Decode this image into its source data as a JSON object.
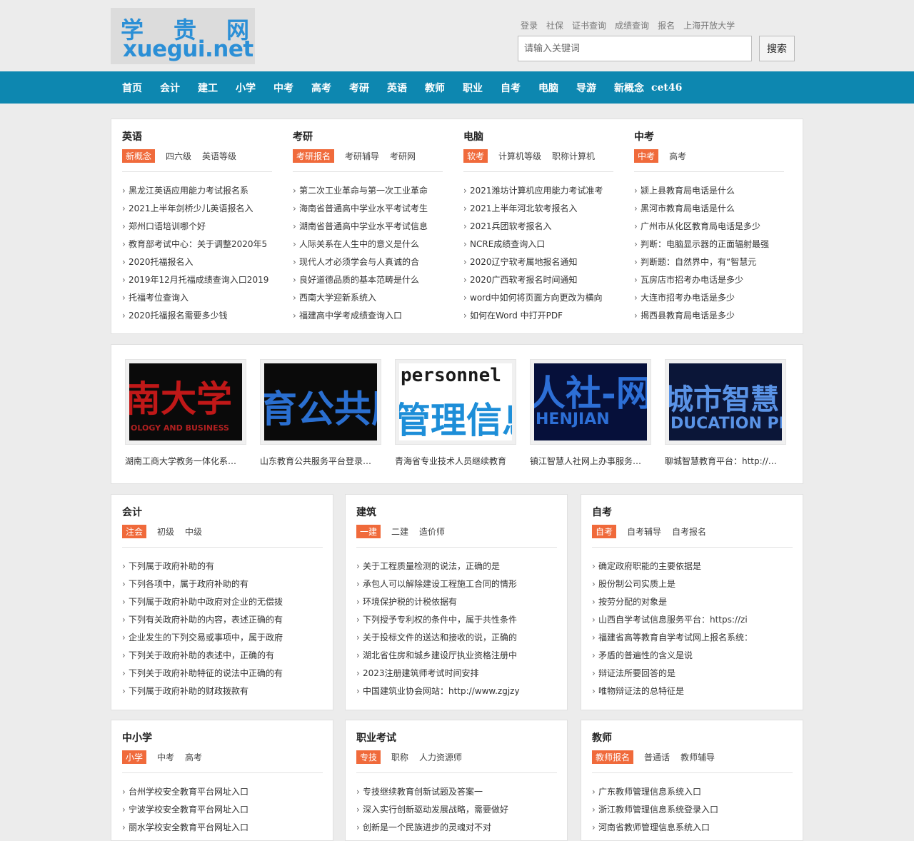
{
  "logo": {
    "zh": [
      "学",
      "贵",
      "网"
    ],
    "en": "xuegui.net"
  },
  "top_links": [
    "登录",
    "社保",
    "证书查询",
    "成绩查询",
    "报名",
    "上海开放大学"
  ],
  "search": {
    "placeholder": "请输入关键词",
    "button": "搜索"
  },
  "nav": [
    "首页",
    "会计",
    "建工",
    "小学",
    "中考",
    "高考",
    "考研",
    "英语",
    "教师",
    "职业",
    "自考",
    "电脑",
    "导游",
    "新概念",
    "cet46"
  ],
  "top_section": [
    {
      "title": "英语",
      "tabs": [
        "新概念",
        "四六级",
        "英语等级"
      ],
      "items": [
        "黑龙江英语应用能力考试报名系",
        "2021上半年剑桥少儿英语报名入",
        "郑州口语培训哪个好",
        "教育部考试中心：关于调整2020年5",
        "2020托福报名入",
        "2019年12月托福成绩查询入口2019",
        "托福考位查询入",
        "2020托福报名需要多少钱"
      ]
    },
    {
      "title": "考研",
      "tabs": [
        "考研报名",
        "考研辅导",
        "考研网"
      ],
      "items": [
        "第二次工业革命与第一次工业革命",
        "海南省普通高中学业水平考试考生",
        "湖南省普通高中学业水平考试信息",
        "人际关系在人生中的意义是什么",
        "现代人才必须学会与人真诚的合",
        "良好道德品质的基本范畴是什么",
        "西南大学迎新系统入",
        "福建高中学考成绩查询入口"
      ]
    },
    {
      "title": "电脑",
      "tabs": [
        "软考",
        "计算机等级",
        "职称计算机"
      ],
      "items": [
        "2021潍坊计算机应用能力考试准考",
        "2021上半年河北软考报名入",
        "2021兵团软考报名入",
        "NCRE成绩查询入口",
        "2020辽宁软考属地报名通知",
        "2020广西软考报名时间通知",
        "word中如何将页面方向更改为横向",
        "如何在Word 中打开PDF"
      ]
    },
    {
      "title": "中考",
      "tabs": [
        "中考",
        "高考"
      ],
      "items": [
        "颍上县教育局电话是什么",
        "黑河市教育局电话是什么",
        "广州市从化区教育局电话是多少",
        "判断：电脑显示器的正面辐射最强",
        "判断题：自然界中，有“智慧元",
        "瓦房店市招考办电话是多少",
        "大连市招考办电话是多少",
        "揭西县教育局电话是多少"
      ]
    }
  ],
  "images": [
    {
      "big": "南大学",
      "sub": "OLOGY AND BUSINESS",
      "caption": "湖南工商大学教务一体化系统入口"
    },
    {
      "big": "育公共服",
      "sub": "",
      "caption": "山东教育公共服务平台登录入口"
    },
    {
      "big": "管理信息系",
      "sub": "personnel",
      "caption": "青海省专业技术人员继续教育"
    },
    {
      "big": "人社-网上",
      "sub": "HENJIAN",
      "caption": "镇江智慧人社网上办事服务大厅"
    },
    {
      "big": "城市智慧",
      "sub": "DUCATION PLATF",
      "caption": "聊城智慧教育平台：http://www"
    }
  ],
  "middle_section": [
    {
      "title": "会计",
      "tabs": [
        "注会",
        "初级",
        "中级"
      ],
      "items": [
        "下列属于政府补助的有",
        "下列各项中，属于政府补助的有",
        "下列属于政府补助中政府对企业的无偿拨",
        "下列有关政府补助的内容，表述正确的有",
        "企业发生的下列交易或事项中，属于政府",
        "下列关于政府补助的表述中，正确的有",
        "下列关于政府补助特征的说法中正确的有",
        "下列属于政府补助的财政拨款有"
      ]
    },
    {
      "title": "建筑",
      "tabs": [
        "一建",
        "二建",
        "造价师"
      ],
      "items": [
        "关于工程质量检测的说法，正确的是",
        "承包人可以解除建设工程施工合同的情形",
        "环境保护税的计税依据有",
        "下列授予专利权的条件中，属于共性条件",
        "关于投标文件的送达和接收的说，正确的",
        "湖北省住房和城乡建设厅执业资格注册中",
        "2023注册建筑师考试时间安排",
        "中国建筑业协会网站：http://www.zgjzy"
      ]
    },
    {
      "title": "自考",
      "tabs": [
        "自考",
        "自考辅导",
        "自考报名"
      ],
      "items": [
        "确定政府职能的主要依据是",
        "股份制公司实质上是",
        "按劳分配的对象是",
        "山西自学考试信息服务平台：https://zi",
        "福建省高等教育自学考试网上报名系统：",
        "矛盾的普遍性的含义是说",
        "辩证法所要回答的是",
        "唯物辩证法的总特征是"
      ]
    }
  ],
  "bottom_section": [
    {
      "title": "中小学",
      "tabs": [
        "小学",
        "中考",
        "高考"
      ],
      "items": [
        "台州学校安全教育平台网址入口",
        "宁波学校安全教育平台网址入口",
        "丽水学校安全教育平台网址入口"
      ]
    },
    {
      "title": "职业考试",
      "tabs": [
        "专技",
        "职称",
        "人力资源师"
      ],
      "items": [
        "专技继续教育创新试题及答案一",
        "深入实行创新驱动发展战略，需要做好",
        "创新是一个民族进步的灵魂对不对"
      ]
    },
    {
      "title": "教师",
      "tabs": [
        "教师报名",
        "普通话",
        "教师辅导"
      ],
      "items": [
        "广东教师管理信息系统入口",
        "浙江教师管理信息系统登录入口",
        "河南省教师管理信息系统入口"
      ]
    }
  ]
}
